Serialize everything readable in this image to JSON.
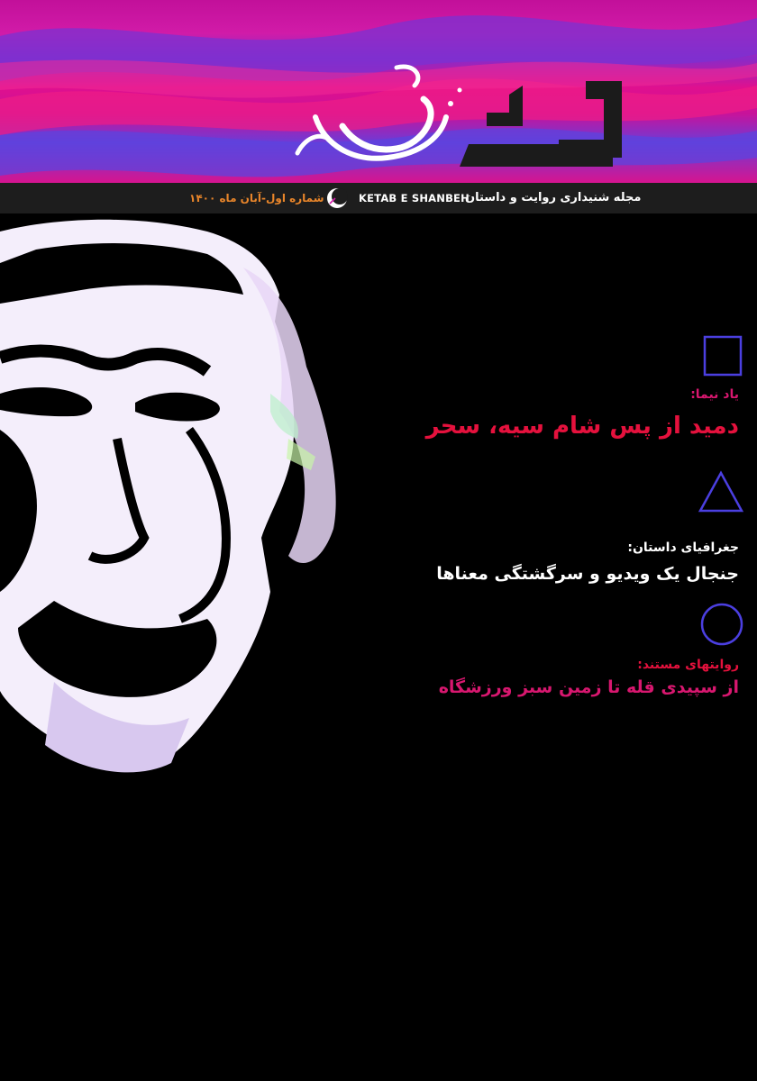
{
  "masthead": {
    "logo_text": "کتاب شنبه",
    "subtitle": "مجله شنیداری روایت و داستان",
    "latin_name": "KETAB E SHANBEH",
    "issue": "شماره اول-آبان ماه ۱۴۰۰",
    "colors": {
      "magenta": "#d11ba8",
      "violet": "#7a3ad8",
      "pink": "#e0108e",
      "bar": "#1d1d1d",
      "issue_orange": "#e8852a"
    },
    "icon": "crescent-moon-icon"
  },
  "articles": [
    {
      "shape": "square-outline-icon",
      "kicker": "یاد نیما:",
      "title": "دمید از پس شام سیه، سحر"
    },
    {
      "shape": "triangle-outline-icon",
      "kicker": "جغرافیای داستان:",
      "title": "جنجال یک ویدیو و سرگشتگی معناها"
    },
    {
      "shape": "circle-outline-icon",
      "kicker": "روایتهای مستند:",
      "title": "از سپیدی قله تا زمین سبز ورزشگاه"
    }
  ],
  "colors": {
    "shape_stroke": "#4b3fe0",
    "accent_red": "#e5113d",
    "accent_pink": "#d8176f",
    "background": "#000000"
  }
}
